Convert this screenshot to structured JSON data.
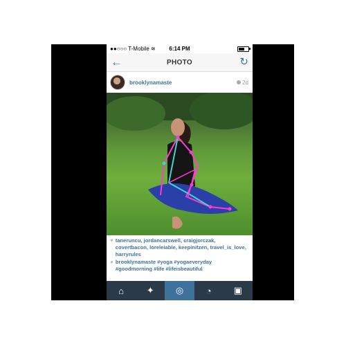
{
  "status_bar": {
    "carrier": "T-Mobile",
    "time": "6:14 PM"
  },
  "nav": {
    "title": "PHOTO"
  },
  "post": {
    "username": "brooklynamaste",
    "age": "2d"
  },
  "captions": {
    "likes": "taneruncu, jordancarswell, craigjorczak, covertbacon, loreleiable, keepinitzen, travel_is_love, harryrules",
    "comment_user": "brooklynamaste",
    "comment_text": "#yoga #yogaeveryday #goodmorning #life #lifeisbeautiful"
  },
  "icons": {
    "back": "arrow-left-icon",
    "refresh": "refresh-icon",
    "tabs": [
      "home-icon",
      "explore-icon",
      "camera-icon",
      "activity-icon",
      "profile-icon"
    ]
  },
  "colors": {
    "link": "#3f729b",
    "tabbar": "#2b3a48",
    "tab_active": "#3f729b"
  }
}
